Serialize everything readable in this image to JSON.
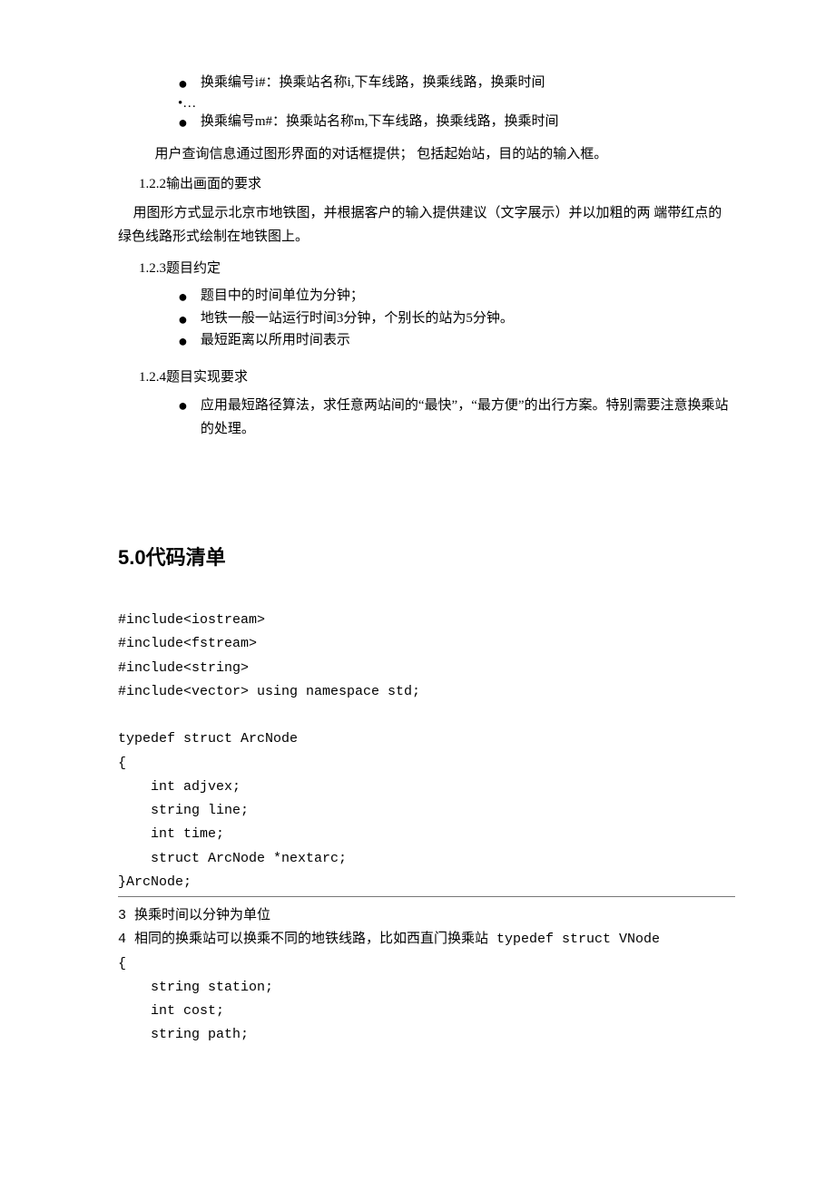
{
  "top_bullets": {
    "i": "换乘编号i#：换乘站名称i,下车线路，换乘线路，换乘时间",
    "m": "换乘编号m#：换乘站名称m,下车线路，换乘线路，换乘时间"
  },
  "ellipsis": "•…",
  "para_user_query": "用户查询信息通过图形界面的对话框提供；  包括起始站，目的站的输入框。",
  "sec_122_title": "1.2.2输出画面的要求",
  "sec_122_body": "用图形方式显示北京市地铁图，并根据客户的输入提供建议（文字展示）并以加粗的两 端带红点的绿色线路形式绘制在地铁图上。",
  "sec_123_title": "1.2.3题目约定",
  "sec_123_bullets": [
    "题目中的时间单位为分钟；",
    "地铁一般一站运行时间3分钟，个别长的站为5分钟。",
    "最短距离以所用时间表示"
  ],
  "sec_124_title": "1.2.4题目实现要求",
  "sec_124_bullet": "应用最短路径算法，求任意两站间的“最快”，“最方便”的出行方案。特别需要注意换乘站的处理。",
  "h2_code": "5.0代码清单",
  "code_main": "#include<iostream>\n#include<fstream>\n#include<string>\n#include<vector> using namespace std;\n\ntypedef struct ArcNode\n{\n    int adjvex;\n    string line;\n    int time;\n    struct ArcNode *nextarc;\n}ArcNode;",
  "footnotes": "3 换乘时间以分钟为单位\n4 相同的换乘站可以换乘不同的地铁线路，比如西直门换乘站 typedef struct VNode\n{\n    string station;\n    int cost;\n    string path;"
}
